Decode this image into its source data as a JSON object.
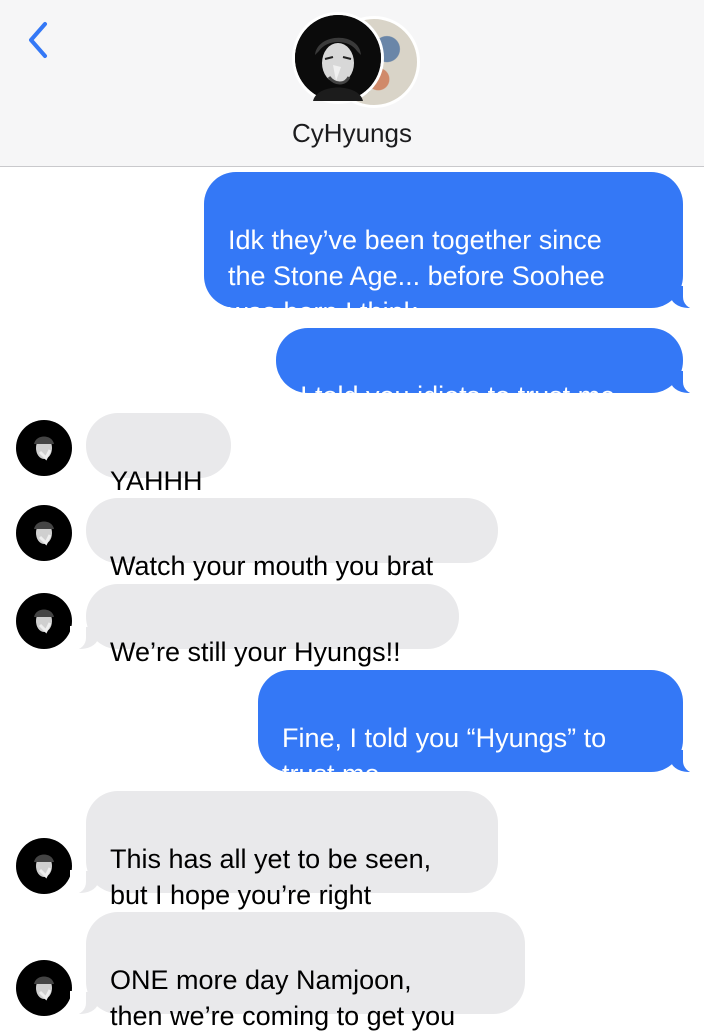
{
  "header": {
    "back_icon": "chevron-left-icon",
    "contact_name": "CyHyungs",
    "accent_color": "#3478f6"
  },
  "messages": [
    {
      "direction": "outgoing",
      "text": "Idk they’ve been together since\nthe Stone Age... before Soohee\nwas born I think"
    },
    {
      "direction": "outgoing",
      "text": "I told you idiots to trust me"
    },
    {
      "direction": "incoming",
      "text": "YAHHH"
    },
    {
      "direction": "incoming",
      "text": "Watch your mouth you brat"
    },
    {
      "direction": "incoming",
      "text": "We’re still your Hyungs!!"
    },
    {
      "direction": "outgoing",
      "text": "Fine, I told you “Hyungs” to\ntrust me"
    },
    {
      "direction": "incoming",
      "text": "This has all yet to be seen,\nbut I hope you’re right"
    },
    {
      "direction": "incoming",
      "text": "ONE more day Namjoon,\nthen we’re coming to get you"
    }
  ]
}
